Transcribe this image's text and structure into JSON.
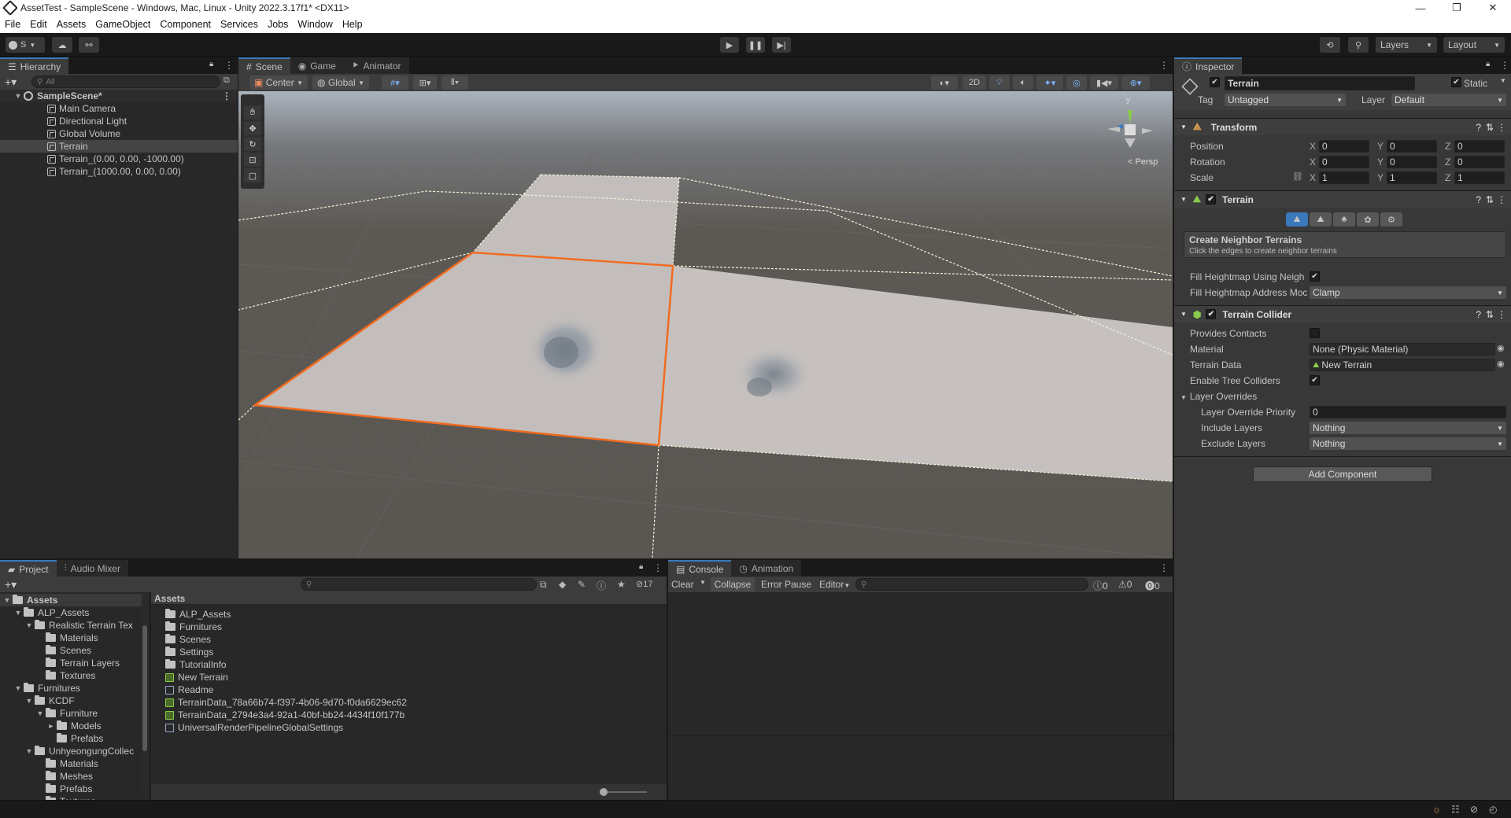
{
  "window": {
    "title": "AssetTest - SampleScene - Windows, Mac, Linux - Unity 2022.3.17f1* <DX11>",
    "controls": [
      "—",
      "❐",
      "✕"
    ]
  },
  "menu": [
    "File",
    "Edit",
    "Assets",
    "GameObject",
    "Component",
    "Services",
    "Jobs",
    "Window",
    "Help"
  ],
  "toolbar": {
    "account_label": "S",
    "layers_label": "Layers",
    "layout_label": "Layout"
  },
  "hierarchy": {
    "tab_label": "Hierarchy",
    "search_placeholder": "All",
    "scene_name": "SampleScene*",
    "items": [
      "Main Camera",
      "Directional Light",
      "Global Volume",
      "Terrain",
      "Terrain_(0.00, 0.00, -1000.00)",
      "Terrain_(1000.00, 0.00, 0.00)"
    ]
  },
  "scene_view": {
    "tabs": [
      "Scene",
      "Game",
      "Animator"
    ],
    "pivot_label": "Center",
    "space_label": "Global",
    "mode_2d_label": "2D",
    "persp_label": "< Persp",
    "gizmo_axis_label": "y"
  },
  "inspector": {
    "tab_label": "Inspector",
    "object_name": "Terrain",
    "static_label": "Static",
    "tag_label": "Tag",
    "tag_value": "Untagged",
    "layer_label": "Layer",
    "layer_value": "Default",
    "transform": {
      "title": "Transform",
      "position_label": "Position",
      "rotation_label": "Rotation",
      "scale_label": "Scale",
      "axis_x": "X",
      "axis_y": "Y",
      "axis_z": "Z",
      "position": [
        "0",
        "0",
        "0"
      ],
      "rotation": [
        "0",
        "0",
        "0"
      ],
      "scale": [
        "1",
        "1",
        "1"
      ]
    },
    "terrain": {
      "title": "Terrain",
      "neighbor_title": "Create Neighbor Terrains",
      "neighbor_hint": "Click the edges to create neighbor terrains",
      "fill_heightmap_label": "Fill Heightmap Using Neigh",
      "fill_address_label": "Fill Heightmap Address Moc",
      "fill_address_value": "Clamp"
    },
    "collider": {
      "title": "Terrain Collider",
      "provides_contacts_label": "Provides Contacts",
      "material_label": "Material",
      "material_value": "None (Physic Material)",
      "terrain_data_label": "Terrain Data",
      "terrain_data_value": "New Terrain",
      "enable_tree_label": "Enable Tree Colliders",
      "layer_overrides_label": "Layer Overrides",
      "override_priority_label": "Layer Override Priority",
      "override_priority_value": "0",
      "include_layers_label": "Include Layers",
      "include_layers_value": "Nothing",
      "exclude_layers_label": "Exclude Layers",
      "exclude_layers_value": "Nothing"
    },
    "add_component_label": "Add Component"
  },
  "project": {
    "tabs": [
      "Project",
      "Audio Mixer"
    ],
    "hidden_count": "17",
    "breadcrumb": "Assets",
    "tree": [
      {
        "label": "Assets",
        "depth": 0,
        "arrow": "▼"
      },
      {
        "label": "ALP_Assets",
        "depth": 1,
        "arrow": "▼"
      },
      {
        "label": "Realistic Terrain Tex",
        "depth": 2,
        "arrow": "▼"
      },
      {
        "label": "Materials",
        "depth": 3,
        "arrow": ""
      },
      {
        "label": "Scenes",
        "depth": 3,
        "arrow": ""
      },
      {
        "label": "Terrain Layers",
        "depth": 3,
        "arrow": ""
      },
      {
        "label": "Textures",
        "depth": 3,
        "arrow": ""
      },
      {
        "label": "Furnitures",
        "depth": 1,
        "arrow": "▼"
      },
      {
        "label": "KCDF",
        "depth": 2,
        "arrow": "▼"
      },
      {
        "label": "Furniture",
        "depth": 3,
        "arrow": "▼"
      },
      {
        "label": "Models",
        "depth": 4,
        "arrow": "►"
      },
      {
        "label": "Prefabs",
        "depth": 4,
        "arrow": ""
      },
      {
        "label": "UnhyeongungCollec",
        "depth": 2,
        "arrow": "▼"
      },
      {
        "label": "Materials",
        "depth": 3,
        "arrow": ""
      },
      {
        "label": "Meshes",
        "depth": 3,
        "arrow": ""
      },
      {
        "label": "Prefabs",
        "depth": 3,
        "arrow": ""
      },
      {
        "label": "Textures",
        "depth": 3,
        "arrow": ""
      }
    ],
    "assets": [
      {
        "label": "ALP_Assets",
        "icon": "folder"
      },
      {
        "label": "Furnitures",
        "icon": "folder"
      },
      {
        "label": "Scenes",
        "icon": "folder"
      },
      {
        "label": "Settings",
        "icon": "folder"
      },
      {
        "label": "TutorialInfo",
        "icon": "folder"
      },
      {
        "label": "New Terrain",
        "icon": "terrain"
      },
      {
        "label": "Readme",
        "icon": "asset"
      },
      {
        "label": "TerrainData_78a66b74-f397-4b06-9d70-f0da6629ec62",
        "icon": "terrain"
      },
      {
        "label": "TerrainData_2794e3a4-92a1-40bf-bb24-4434f10f177b",
        "icon": "terrain"
      },
      {
        "label": "UniversalRenderPipelineGlobalSettings",
        "icon": "asset"
      }
    ]
  },
  "console": {
    "tabs": [
      "Console",
      "Animation"
    ],
    "clear_label": "Clear",
    "collapse_label": "Collapse",
    "error_pause_label": "Error Pause",
    "editor_label": "Editor",
    "counts": [
      "0",
      "0",
      "0"
    ]
  },
  "colors": {
    "accent": "#3a79bb",
    "selection_orange": "#f26b1f",
    "panel": "#282828",
    "dark": "#191919"
  }
}
